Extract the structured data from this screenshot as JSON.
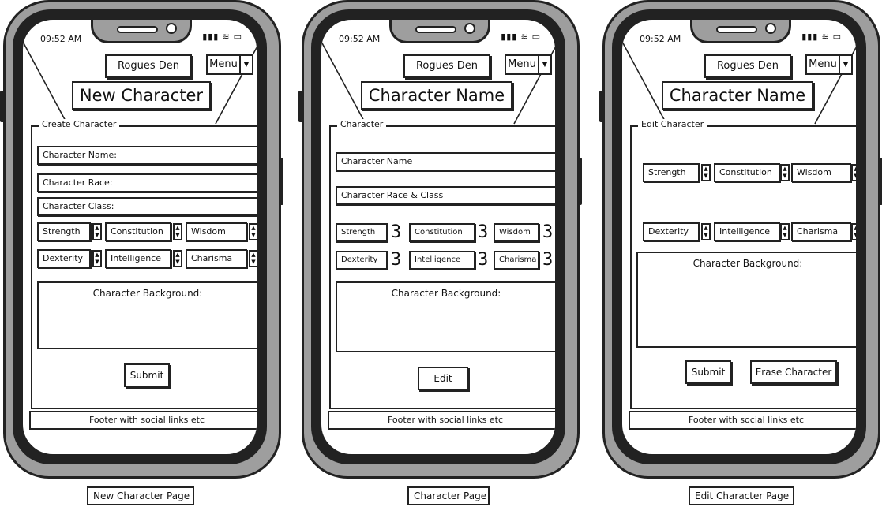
{
  "status": {
    "time": "09:52 AM",
    "icons": [
      "signal-icon",
      "wifi-icon",
      "battery-icon"
    ]
  },
  "header": {
    "brand": "Rogues Den",
    "menu_label": "Menu",
    "menu_caret": "▼"
  },
  "footer": {
    "text": "Footer with social links etc"
  },
  "spinner_glyphs": {
    "up": "▲",
    "down": "▼"
  },
  "screens": {
    "new": {
      "title": "New Character",
      "section": "Create Character",
      "fields": [
        "Character Name:",
        "Character Race:",
        "Character Class:"
      ],
      "stats": [
        "Strength",
        "Constitution",
        "Wisdom",
        "Dexterity",
        "Intelligence",
        "Charisma"
      ],
      "background_label": "Character Background:",
      "submit_label": "Submit",
      "caption": "New Character Page"
    },
    "view": {
      "title": "Character Name",
      "section": "Character",
      "fields": [
        "Character Name",
        "Character Race & Class"
      ],
      "stats": [
        "Strength",
        "Constitution",
        "Wisdom",
        "Dexterity",
        "Intelligence",
        "Charisma"
      ],
      "stat_values": [
        "3",
        "3",
        "3",
        "3",
        "3",
        "3"
      ],
      "background_label": "Character Background:",
      "edit_label": "Edit",
      "caption": "Character Page"
    },
    "edit": {
      "title": "Character Name",
      "section": "Edit Character",
      "stats": [
        "Strength",
        "Constitution",
        "Wisdom",
        "Dexterity",
        "Intelligence",
        "Charisma"
      ],
      "background_label": "Character Background:",
      "submit_label": "Submit",
      "erase_label": "Erase Character",
      "caption": "Edit Character Page"
    }
  }
}
